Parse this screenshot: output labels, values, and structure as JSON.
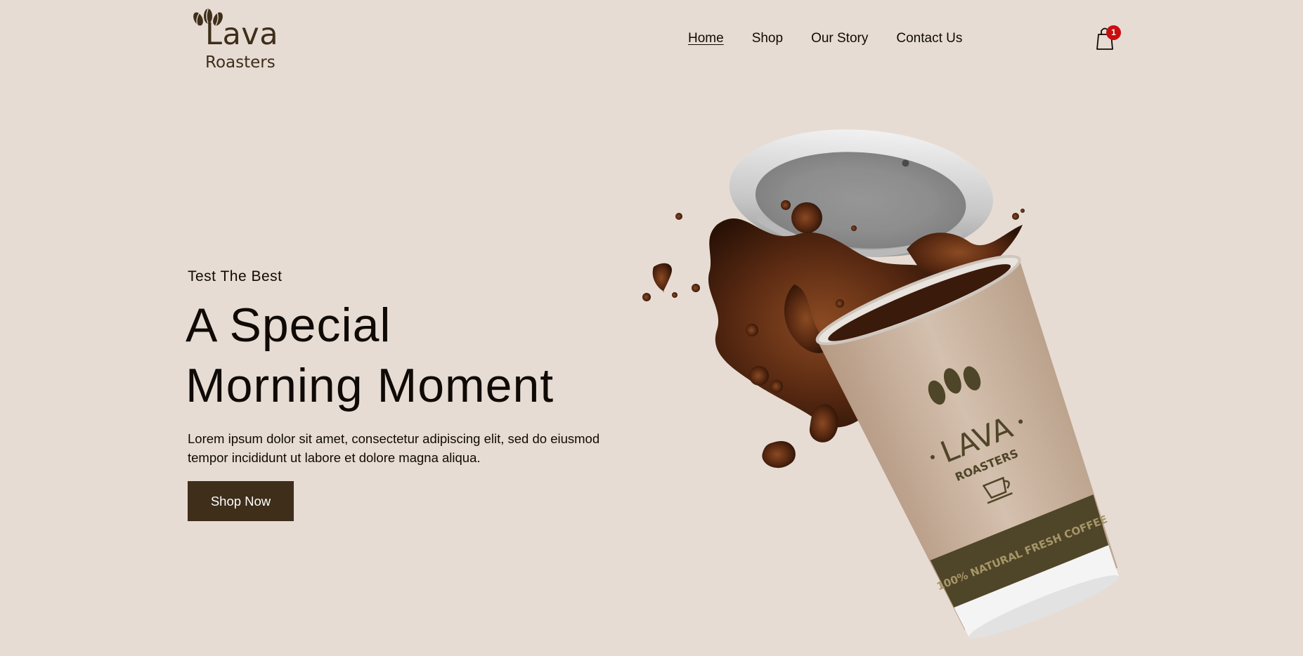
{
  "brand": {
    "name": "Lava",
    "tagline": "Roasters"
  },
  "nav": {
    "items": [
      {
        "label": "Home",
        "active": true
      },
      {
        "label": "Shop",
        "active": false
      },
      {
        "label": "Our Story",
        "active": false
      },
      {
        "label": "Contact Us",
        "active": false
      }
    ]
  },
  "cart": {
    "icon": "shopping-bag-icon",
    "count": "1"
  },
  "hero": {
    "eyebrow": "Test The Best",
    "headline_line1": "A Special",
    "headline_line2": "Morning Moment",
    "description_line1": "Lorem ipsum dolor sit amet, consectetur adipiscing elit, sed do eiusmod",
    "description_line2": "tempor incididunt ut labore et dolore magna aliqua.",
    "cta_label": "Shop Now"
  },
  "product_image": {
    "cup_brand": "LAVA",
    "cup_sub": "ROASTERS",
    "cup_band": "100% NATURAL FRESH COFFEE"
  },
  "colors": {
    "background": "#e7dcd3",
    "brand_dark": "#3e2e1a",
    "text": "#0f0a06",
    "badge": "#c90e0e",
    "cup_paper": "#c9b3a0",
    "cup_band": "#4f4528",
    "coffee": "#4a220f"
  }
}
